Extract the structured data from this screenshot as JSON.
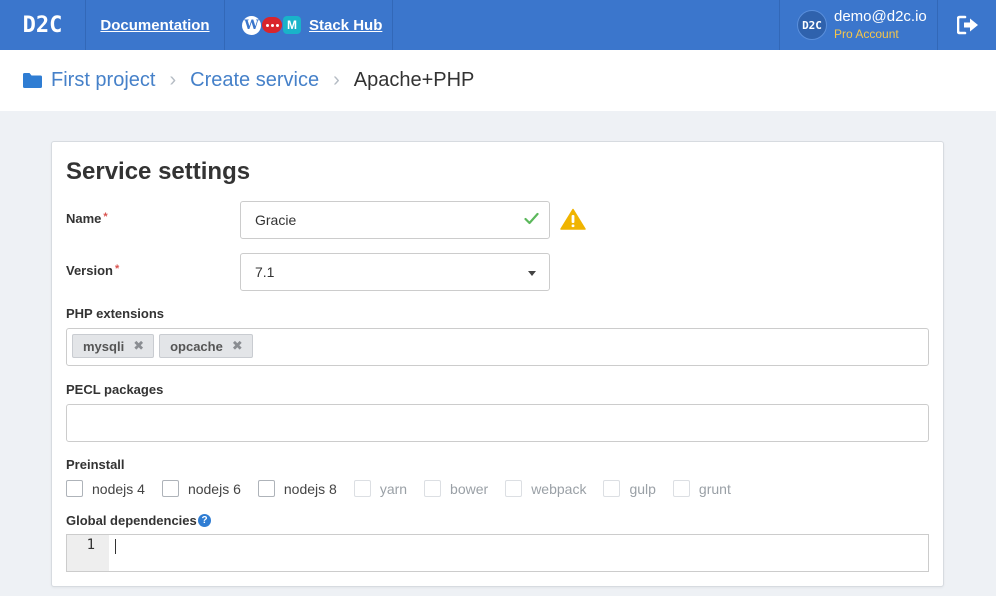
{
  "header": {
    "logo": "D2C",
    "documentation": "Documentation",
    "stack_hub": "Stack Hub",
    "account_avatar": "D2C",
    "account_email": "demo@d2c.io",
    "account_plan": "Pro Account"
  },
  "breadcrumb": {
    "items": [
      "First project",
      "Create service"
    ],
    "separator": "›",
    "current": "Apache+PHP"
  },
  "form": {
    "title": "Service settings",
    "required_mark": "*",
    "name_label": "Name",
    "name_value": "Gracie",
    "version_label": "Version",
    "version_value": "7.1",
    "php_ext_label": "PHP extensions",
    "php_extensions": [
      "mysqli",
      "opcache"
    ],
    "tag_remove": "✖",
    "pecl_label": "PECL packages",
    "pecl_value": "",
    "preinstall_label": "Preinstall",
    "preinstall": [
      {
        "label": "nodejs 4",
        "enabled": true,
        "checked": false
      },
      {
        "label": "nodejs 6",
        "enabled": true,
        "checked": false
      },
      {
        "label": "nodejs 8",
        "enabled": true,
        "checked": false
      },
      {
        "label": "yarn",
        "enabled": false,
        "checked": false
      },
      {
        "label": "bower",
        "enabled": false,
        "checked": false
      },
      {
        "label": "webpack",
        "enabled": false,
        "checked": false
      },
      {
        "label": "gulp",
        "enabled": false,
        "checked": false
      },
      {
        "label": "grunt",
        "enabled": false,
        "checked": false
      }
    ],
    "global_deps_label": "Global dependencies",
    "help_glyph": "?",
    "editor_line_number": "1"
  },
  "colors": {
    "topbar": "#3b76cc",
    "link": "#4681c9",
    "required": "#d9534f",
    "valid_check": "#5cb85c",
    "warning": "#f0b400",
    "pro_account": "#f6c64a"
  },
  "icons": [
    "folder-icon",
    "wordpress-icon",
    "chat-icon",
    "m-icon",
    "logout-icon",
    "check-icon",
    "warning-icon",
    "caret-down-icon",
    "remove-tag-icon",
    "help-icon"
  ]
}
